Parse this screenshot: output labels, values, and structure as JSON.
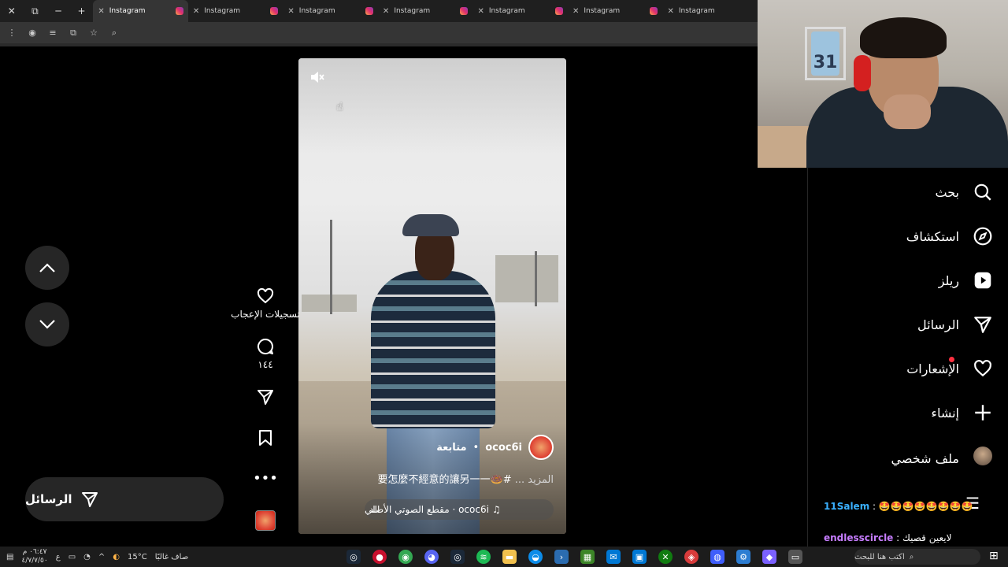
{
  "browser": {
    "tabs": [
      {
        "label": "Instagram",
        "active": true
      },
      {
        "label": "Instagram",
        "active": false
      },
      {
        "label": "Instagram",
        "active": false
      },
      {
        "label": "Instagram",
        "active": false
      },
      {
        "label": "Instagram",
        "active": false
      },
      {
        "label": "Instagram",
        "active": false
      },
      {
        "label": "Instagram",
        "active": false
      }
    ],
    "close_glyph": "✕",
    "new_tab_glyph": "+",
    "minimize_glyph": "─",
    "restore_glyph": "⧉"
  },
  "reel": {
    "author": "ococ6i",
    "follow_label": "متابعة",
    "separator": "•",
    "caption_text": "#🍩要怎麼不經意的讓另一一",
    "caption_more": "المزيد ...",
    "audio_label": "ococ6i · مقطع الصوتي الأصلي",
    "audio_prefix": "الد",
    "mute_icon": "speaker-muted-icon"
  },
  "actions": {
    "likes_label": "تسجيلات الإعجاب",
    "comments_count": "١٤٤"
  },
  "messages_pill": {
    "label": "الرسائل"
  },
  "sidebar": {
    "items": [
      {
        "label": "بحث",
        "icon": "search-icon"
      },
      {
        "label": "استكشاف",
        "icon": "compass-icon"
      },
      {
        "label": "ريلز",
        "icon": "reels-icon"
      },
      {
        "label": "الرسائل",
        "icon": "send-icon"
      },
      {
        "label": "الإشعارات",
        "icon": "heart-icon"
      },
      {
        "label": "إنشاء",
        "icon": "plus-icon"
      },
      {
        "label": "ملف شخصي",
        "icon": "avatar"
      }
    ]
  },
  "webcam": {
    "jersey_number": "31"
  },
  "chat": {
    "msg1_user": "11Salem",
    "msg1_text": ": 🤩🤩🤩🤩🤩🤩🤩🤩",
    "msg2_user": "endlesscircle",
    "msg2_text": ": لايعين قصيك"
  },
  "taskbar": {
    "clock_time": "٠٦:٤٧ م",
    "clock_date": "٤/٧/٧/٥٠",
    "lang": "ع",
    "weather": "15°C",
    "weather_text": "صاف غالبًا",
    "search_placeholder": "اكتب هنا للبحث"
  }
}
